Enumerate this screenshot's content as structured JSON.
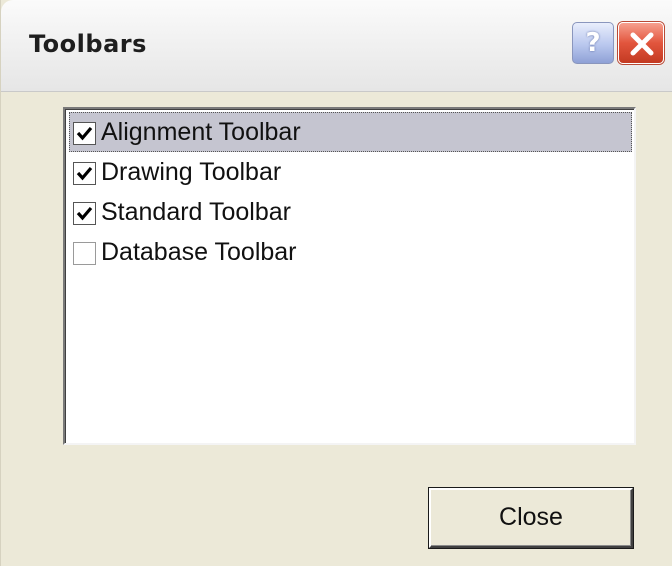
{
  "window": {
    "title": "Toolbars",
    "help_glyph": "?",
    "help_icon": "question-mark-icon",
    "close_icon": "close-x-icon",
    "close_button_color": "#d9462b",
    "help_button_color": "#b9c7ee"
  },
  "toolbars": {
    "items": [
      {
        "label": "Alignment Toolbar",
        "checked": true,
        "selected": true
      },
      {
        "label": "Drawing Toolbar",
        "checked": true,
        "selected": false
      },
      {
        "label": "Standard Toolbar",
        "checked": true,
        "selected": false
      },
      {
        "label": "Database Toolbar",
        "checked": false,
        "selected": false
      }
    ]
  },
  "footer": {
    "close_label": "Close"
  }
}
